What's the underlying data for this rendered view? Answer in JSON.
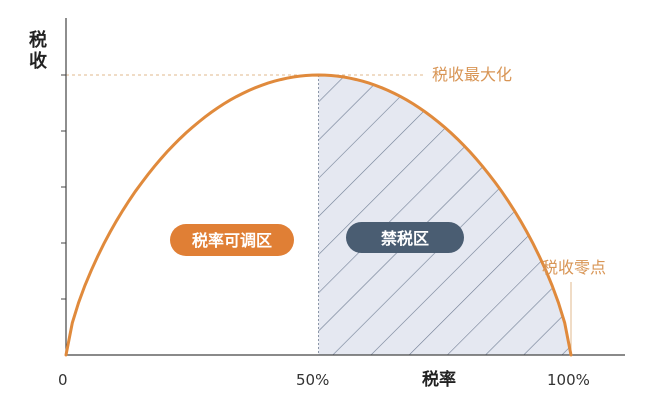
{
  "axes": {
    "y_title_line1": "税",
    "y_title_line2": "收",
    "x_title": "税率"
  },
  "ticks": {
    "x0": "0",
    "x50": "50%",
    "x100": "100%"
  },
  "curve": {
    "peak_at": 0.5,
    "peak_value": 1.0,
    "zero_points": [
      0,
      1
    ]
  },
  "annotations": {
    "max_label": "税收最大化",
    "zero_label": "税收零点"
  },
  "regions": {
    "adjustable_label": "税率可调区",
    "forbidden_label": "禁税区"
  },
  "colors": {
    "curve": "#e08a3c",
    "annotation_text": "#d89555",
    "annotation_line": "#e0b88d",
    "pill_adjustable": "#e07f35",
    "pill_forbidden": "#4a5d72",
    "hatch_fill": "#e5e8f1",
    "hatch_line": "#6f7d93",
    "axis": "#444444"
  }
}
